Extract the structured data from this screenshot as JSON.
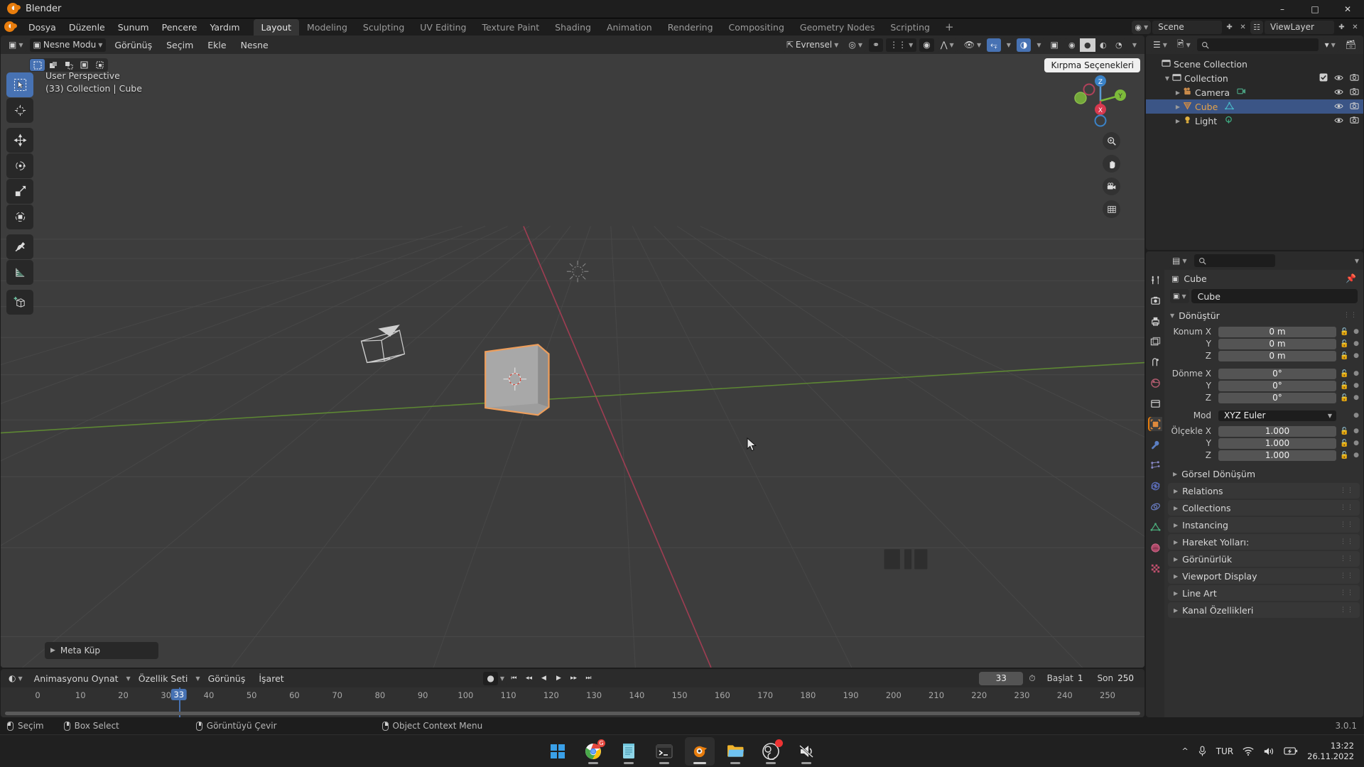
{
  "window": {
    "title": "Blender",
    "minimize": "–",
    "maximize": "□",
    "close": "✕"
  },
  "topbar": {
    "menus": [
      "Dosya",
      "Düzenle",
      "Sunum",
      "Pencere",
      "Yardım"
    ],
    "tabs": [
      "Layout",
      "Modeling",
      "Sculpting",
      "UV Editing",
      "Texture Paint",
      "Shading",
      "Animation",
      "Rendering",
      "Compositing",
      "Geometry Nodes",
      "Scripting"
    ],
    "active_tab": "Layout",
    "add_tab": "+",
    "scene_name": "Scene",
    "viewlayer_name": "ViewLayer"
  },
  "viewport_header": {
    "mode": "Nesne Modu",
    "menus": [
      "Görünüş",
      "Seçim",
      "Ekle",
      "Nesne"
    ],
    "transform_orientation": "Evrensel"
  },
  "viewport": {
    "perspective_label": "User Perspective",
    "scene_label": "(33) Collection | Cube",
    "crop_tooltip": "Kırpma Seçenekleri",
    "operator_panel": "Meta Küp",
    "gizmo_axes": [
      "X",
      "Y",
      "Z"
    ],
    "tools": [
      {
        "name": "tweak-select-tool",
        "active": true
      },
      {
        "name": "cursor-tool",
        "active": false
      },
      {
        "name": "move-tool",
        "active": false
      },
      {
        "name": "rotate-tool",
        "active": false
      },
      {
        "name": "scale-tool",
        "active": false
      },
      {
        "name": "transform-tool",
        "active": false
      },
      {
        "name": "annotate-tool",
        "active": false
      },
      {
        "name": "measure-tool",
        "active": false
      },
      {
        "name": "add-cube-tool",
        "active": false
      }
    ]
  },
  "outliner": {
    "rows": [
      {
        "label": "Scene Collection",
        "indent": 0,
        "icon": "collection-icon",
        "selected": false,
        "has_disclosure": false,
        "show_checkbox": false,
        "show_eye": false
      },
      {
        "label": "Collection",
        "indent": 1,
        "icon": "collection-icon",
        "selected": false,
        "has_disclosure": true,
        "show_checkbox": true,
        "show_eye": true
      },
      {
        "label": "Camera",
        "indent": 2,
        "icon": "camera-icon",
        "selected": false,
        "has_disclosure": true,
        "show_checkbox": false,
        "show_eye": true
      },
      {
        "label": "Cube",
        "indent": 2,
        "icon": "mesh-icon",
        "selected": true,
        "has_disclosure": true,
        "show_checkbox": false,
        "show_eye": true
      },
      {
        "label": "Light",
        "indent": 2,
        "icon": "light-icon",
        "selected": false,
        "has_disclosure": true,
        "show_checkbox": false,
        "show_eye": true
      }
    ]
  },
  "properties": {
    "breadcrumb_object": "Cube",
    "id_name": "Cube",
    "transform_panel": "Dönüştür",
    "location": {
      "label": "Konum X",
      "x": "0 m",
      "y": "0 m",
      "z": "0 m"
    },
    "rotation": {
      "label": "Dönme X",
      "x": "0°",
      "y": "0°",
      "z": "0°"
    },
    "rotation_mode": {
      "label": "Mod",
      "value": "XYZ Euler"
    },
    "scale": {
      "label": "Ölçekle X",
      "x": "1.000",
      "y": "1.000",
      "z": "1.000"
    },
    "axis_y": "Y",
    "axis_z": "Z",
    "delta_transform": "Görsel Dönüşüm",
    "panels": [
      "Relations",
      "Collections",
      "Instancing",
      "Hareket Yolları:",
      "Görünürlük",
      "Viewport Display",
      "Line Art",
      "Kanal Özellikleri"
    ]
  },
  "timeline": {
    "menus": [
      "Animasyonu Oynat",
      "Özellik Seti",
      "Görünüş",
      "İşaret"
    ],
    "current_frame": "33",
    "start_label": "Başlat",
    "start_value": "1",
    "end_label": "Son",
    "end_value": "250",
    "ticks": [
      "0",
      "10",
      "20",
      "30",
      "40",
      "50",
      "60",
      "70",
      "80",
      "90",
      "100",
      "110",
      "120",
      "130",
      "140",
      "150",
      "160",
      "170",
      "180",
      "190",
      "200",
      "210",
      "220",
      "230",
      "240",
      "250"
    ]
  },
  "statusbar": {
    "items": [
      {
        "label": "Seçim",
        "mouse": "l"
      },
      {
        "label": "Box Select",
        "mouse": "m"
      },
      {
        "label": "Görüntüyü Çevir",
        "mouse": "m"
      },
      {
        "label": "Object Context Menu",
        "mouse": "r"
      }
    ],
    "version": "3.0.1"
  },
  "taskbar": {
    "apps": [
      {
        "name": "start-button",
        "badge": ""
      },
      {
        "name": "chrome-icon",
        "badge": "G"
      },
      {
        "name": "notepad-icon",
        "badge": ""
      },
      {
        "name": "terminal-icon",
        "badge": ""
      },
      {
        "name": "blender-icon",
        "badge": "",
        "active": true
      },
      {
        "name": "file-explorer-icon",
        "badge": ""
      },
      {
        "name": "obs-icon",
        "badge": " "
      },
      {
        "name": "audio-app-icon",
        "badge": ""
      }
    ],
    "language": "TUR",
    "time": "13:22",
    "date": "26.11.2022"
  },
  "colors": {
    "accent": "#4772b3",
    "orange": "#e87d0d",
    "selected_outline": "#ed9e5c",
    "axis_x": "#c0384e",
    "axis_y": "#6a9f35",
    "bg_dark": "#1d1d1d",
    "bg_panel": "#303030",
    "viewport_bg": "#3d3d3d"
  }
}
